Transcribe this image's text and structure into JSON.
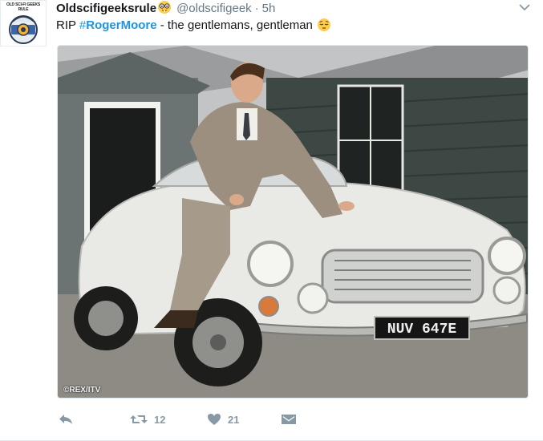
{
  "user": {
    "display_name": "Oldscifigeeksrule",
    "handle": "@oldscifigeek",
    "time": "5h",
    "avatar_text": "OLD SCI-FI GEEKS RULE",
    "name_emoji": "nerd-face-emoji"
  },
  "tweet": {
    "text_prefix": "RIP ",
    "hashtag_symbol": "#",
    "hashtag_word": "RogerMoore",
    "text_suffix": " - the gentlemans, gentleman",
    "trailing_emoji": "pensive-face-emoji"
  },
  "media": {
    "watermark": "©REX/ITV",
    "license_plate": "NUV 647E"
  },
  "actions": {
    "reply_icon": "reply-icon",
    "retweet_icon": "retweet-icon",
    "retweet_count": "12",
    "like_icon": "heart-icon",
    "like_count": "21",
    "dm_icon": "envelope-icon",
    "menu_icon": "chevron-down-icon"
  },
  "colors": {
    "link": "#1b95e0",
    "muted": "#657786",
    "action": "#8899a6",
    "text": "#14171a"
  }
}
